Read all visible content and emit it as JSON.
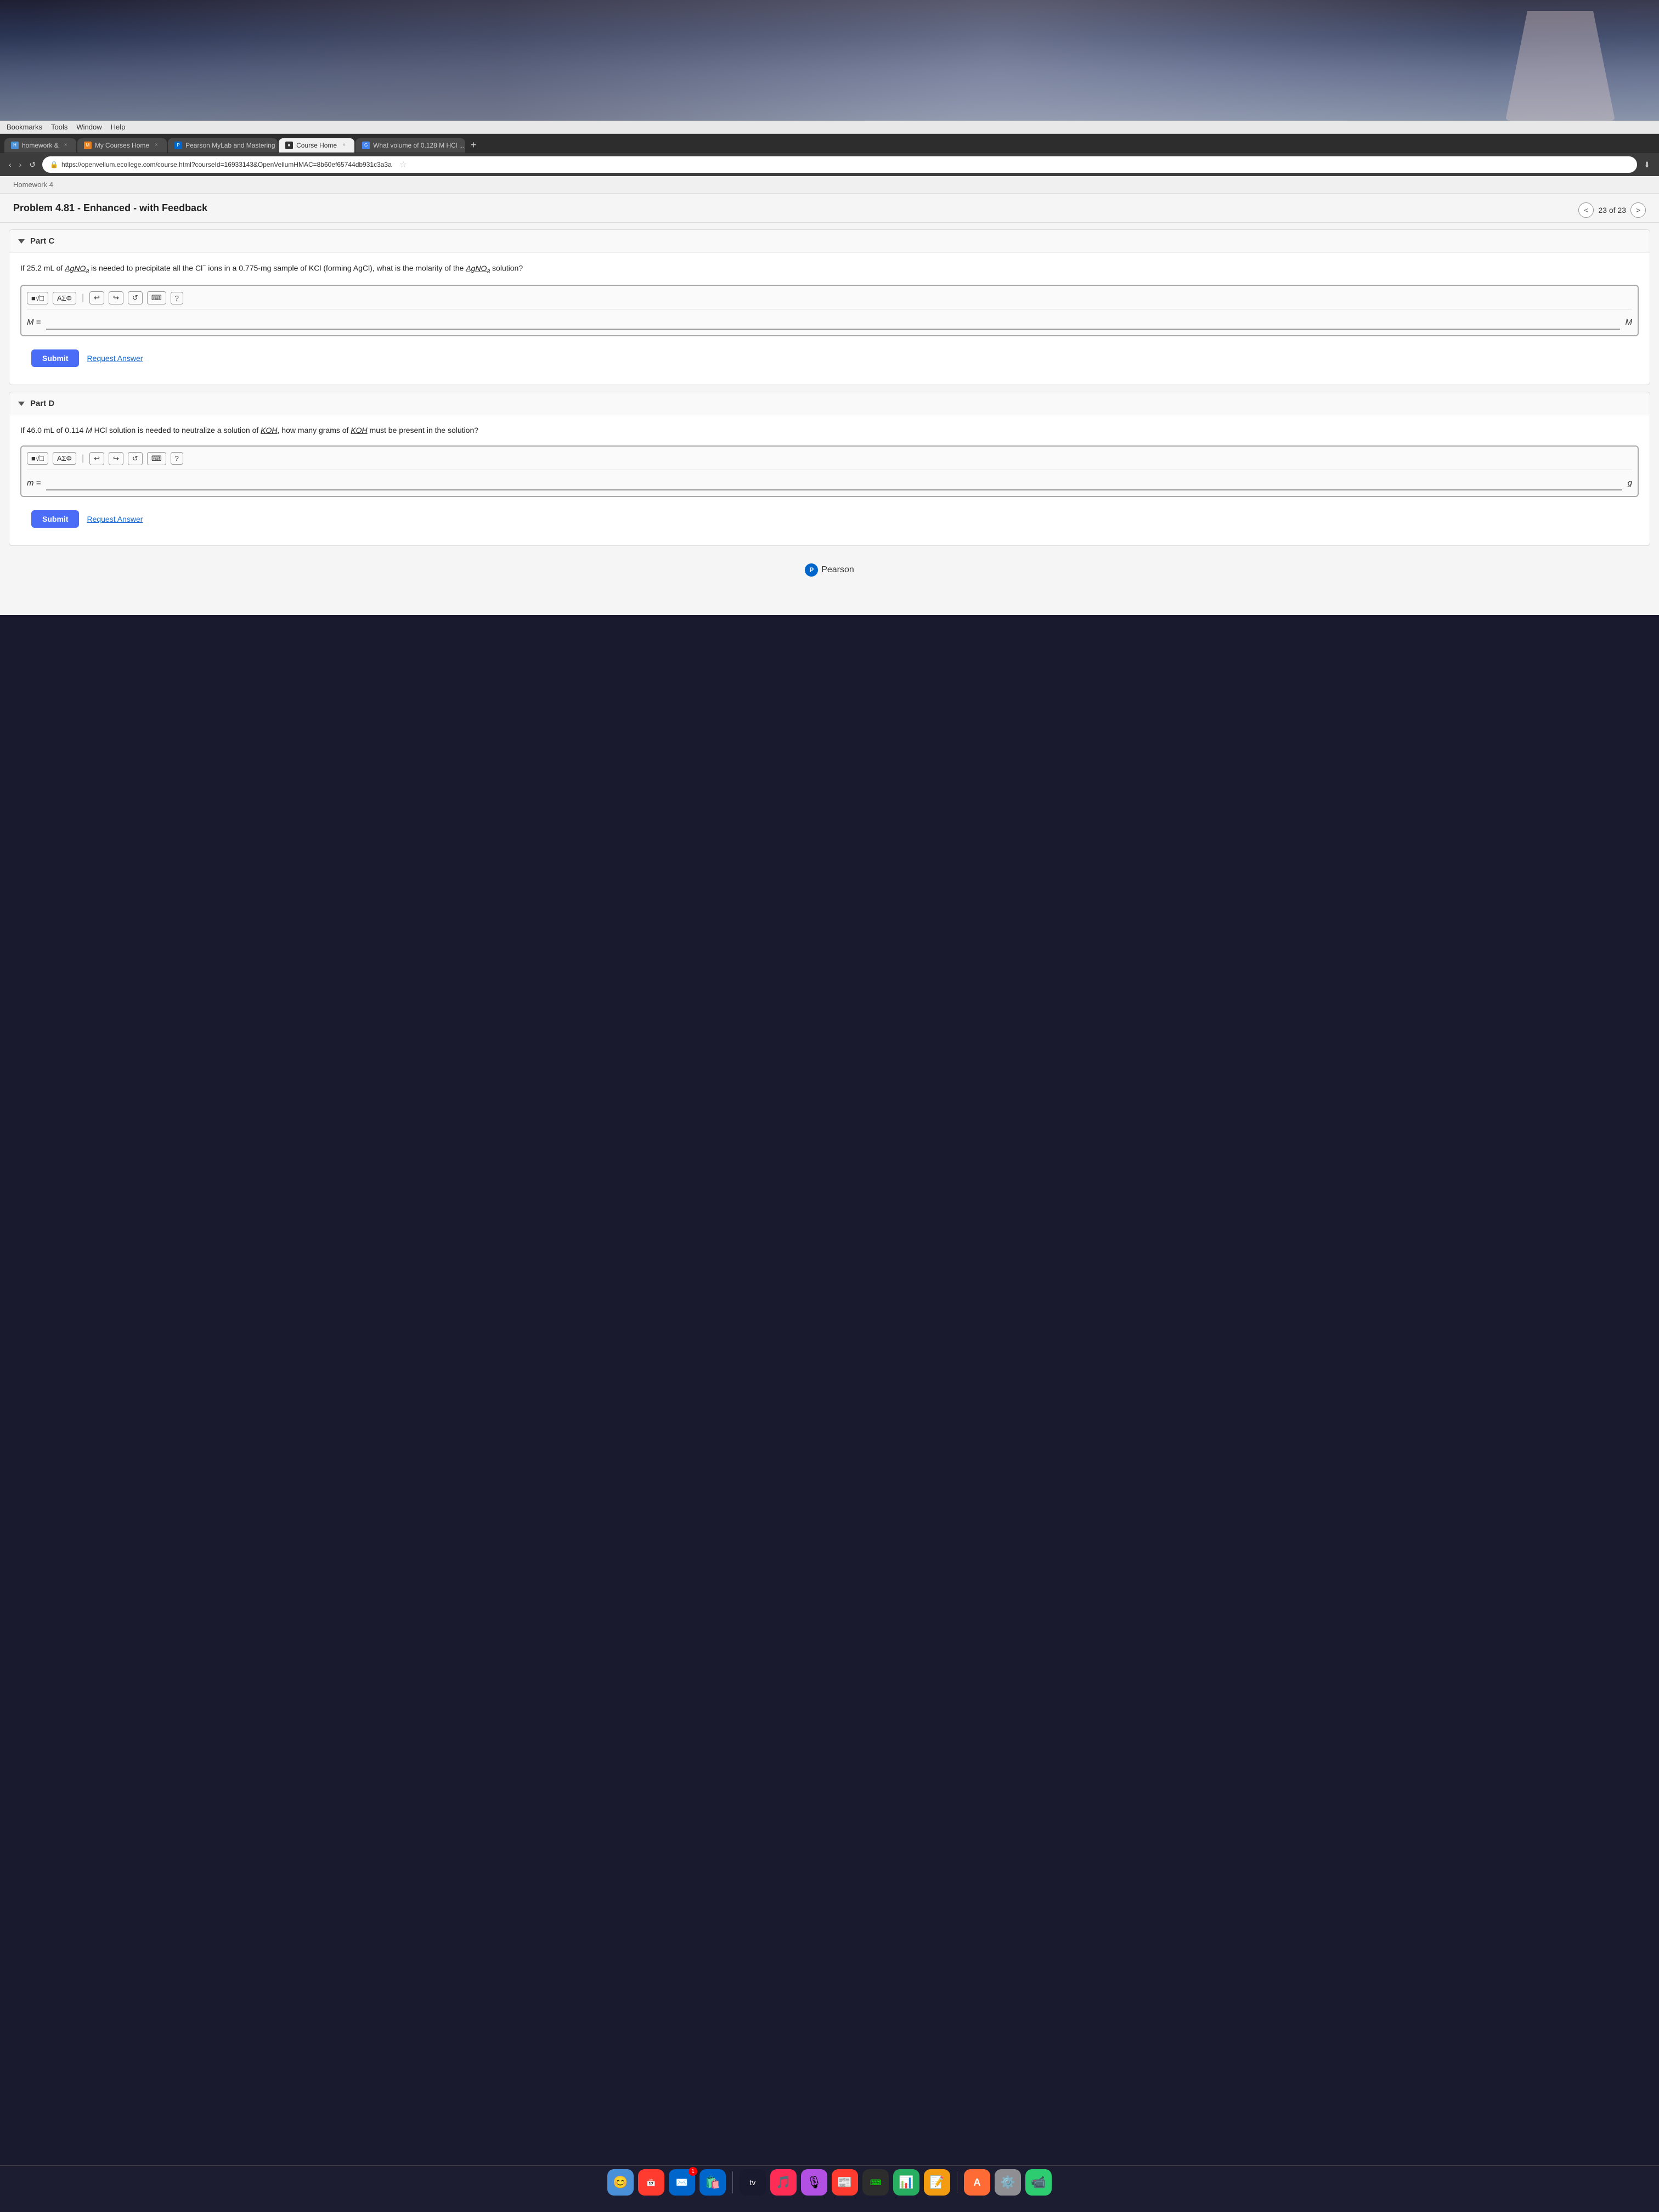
{
  "menu": {
    "items": [
      "Bookmarks",
      "Tools",
      "Window",
      "Help"
    ]
  },
  "tabs": [
    {
      "id": "homework",
      "label": "homework &",
      "active": false,
      "favicon": "H",
      "closable": true
    },
    {
      "id": "mycourses",
      "label": "My Courses Home",
      "active": false,
      "favicon": "M",
      "closable": true
    },
    {
      "id": "pearson",
      "label": "Pearson MyLab and Mastering",
      "active": false,
      "favicon": "P",
      "closable": true
    },
    {
      "id": "coursehome",
      "label": "Course Home",
      "active": true,
      "favicon": "C",
      "closable": true
    },
    {
      "id": "google",
      "label": "What volume of 0.128 M HCl ...",
      "active": false,
      "favicon": "G",
      "closable": true
    }
  ],
  "address_bar": {
    "url": "https://openvellum.ecollege.com/course.html?courseId=16933143&OpenVellumHMAC=8b60ef65744db931c3a3a",
    "secure": true,
    "lock_label": "🔒"
  },
  "page": {
    "breadcrumb": "Homework 4",
    "problem_title": "Problem 4.81 - Enhanced - with Feedback",
    "pagination": {
      "current": "23 of 23",
      "prev_label": "<",
      "next_label": ">"
    }
  },
  "part_c": {
    "header": "Part C",
    "question": "If 25.2 mL of AgNO₃ is needed to precipitate all the Cl⁻ ions in a 0.775-mg sample of KCl (forming AgCl), what is the molarity of the AgNO₃ solution?",
    "var_label": "M =",
    "unit": "M",
    "input_placeholder": "",
    "toolbar": {
      "buttons": [
        "■√□",
        "ΑΣΦ",
        "↩",
        "↪",
        "↺",
        "⌨",
        "?"
      ]
    },
    "submit_label": "Submit",
    "request_answer_label": "Request Answer"
  },
  "part_d": {
    "header": "Part D",
    "question": "If 46.0 mL of 0.114 M HCl solution is needed to neutralize a solution of KOH, how many grams of KOH must be present in the solution?",
    "var_label": "m =",
    "unit": "g",
    "input_placeholder": "",
    "toolbar": {
      "buttons": [
        "■√□",
        "ΑΣΦ",
        "↩",
        "↪",
        "↺",
        "⌨",
        "?"
      ]
    },
    "submit_label": "Submit",
    "request_answer_label": "Request Answer"
  },
  "footer": {
    "brand": "Pearson",
    "logo_letter": "P"
  },
  "dock": {
    "items": [
      {
        "id": "finder",
        "emoji": "😊",
        "color": "#4a90d9"
      },
      {
        "id": "calendar",
        "emoji": "📅",
        "color": "#ff3b30"
      },
      {
        "id": "appstore",
        "emoji": "🛍",
        "color": "#0066cc"
      },
      {
        "id": "music",
        "emoji": "🎵",
        "color": "#fa2d55"
      },
      {
        "id": "podcasts",
        "emoji": "🎙",
        "color": "#b150e2"
      },
      {
        "id": "news",
        "emoji": "📰",
        "color": "#333"
      },
      {
        "id": "iterm",
        "emoji": "💻",
        "color": "#2ecc71"
      },
      {
        "id": "charts",
        "emoji": "📊",
        "color": "#27ae60"
      },
      {
        "id": "notes",
        "emoji": "📝",
        "color": "#f1c40f"
      },
      {
        "id": "swift",
        "emoji": "A",
        "color": "#ff6b35"
      },
      {
        "id": "settings",
        "emoji": "⚙",
        "color": "#8e8e93"
      },
      {
        "id": "facetime",
        "emoji": "📹",
        "color": "#2ecc71"
      }
    ]
  }
}
